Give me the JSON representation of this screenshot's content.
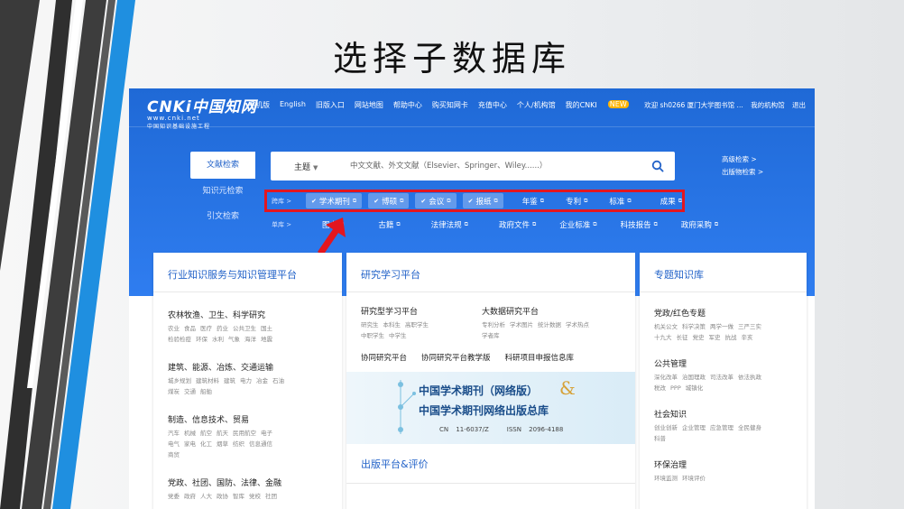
{
  "slide": {
    "title": "选择子数据库"
  },
  "logo": {
    "main": "CNKi中国知网",
    "url": "www.cnki.net",
    "sub": "中国知识基础设施工程"
  },
  "topnav": [
    "手机版",
    "English",
    "旧版入口",
    "网站地图",
    "帮助中心",
    "购买知网卡",
    "充值中心",
    "个人/机构馆",
    "我的CNKI"
  ],
  "topnav_badge": "NEW",
  "user": {
    "welcome": "欢迎  sh0266 厦门大学图书馆 ...",
    "links": [
      "我的机构馆",
      "退出"
    ]
  },
  "side_tabs": [
    "文献检索",
    "知识元检索",
    "引文检索"
  ],
  "search": {
    "field": "主题",
    "placeholder": "中文文献、外文文献（Elsevier、Springer、Wiley......）"
  },
  "adv_links": [
    "高级检索  >",
    "出版物检索  >"
  ],
  "db_row1": {
    "prefix": "跨库  >",
    "selected": [
      "学术期刊",
      "博硕",
      "会议",
      "报纸"
    ],
    "plain": [
      "年鉴",
      "专利",
      "标准",
      "成果"
    ]
  },
  "db_row2": {
    "prefix": "单库  >",
    "items": [
      "图书",
      "古籍",
      "法律法规",
      "政府文件",
      "企业标准",
      "科技报告",
      "政府采购"
    ]
  },
  "panel1": {
    "title": "行业知识服务与知识管理平台",
    "categories": [
      {
        "title": "农林牧渔、卫生、科学研究",
        "subs": [
          "农业",
          "食品",
          "医疗",
          "药业",
          "公共卫生",
          "国土",
          "检验检疫",
          "环保",
          "水利",
          "气象",
          "海洋",
          "地震"
        ]
      },
      {
        "title": "建筑、能源、冶炼、交通运输",
        "subs": [
          "城乡规划",
          "建筑材料",
          "建筑",
          "电力",
          "冶金",
          "石油",
          "煤炭",
          "交通",
          "船舶"
        ]
      },
      {
        "title": "制造、信息技术、贸易",
        "subs": [
          "汽车",
          "机械",
          "航空",
          "航天",
          "民用航空",
          "电子",
          "电气",
          "家电",
          "化工",
          "烟草",
          "纺织",
          "信息通信",
          "商贸"
        ]
      },
      {
        "title": "党政、社团、国防、法律、金融",
        "subs": [
          "党委",
          "政府",
          "人大",
          "政协",
          "智库",
          "党校",
          "社团"
        ]
      }
    ]
  },
  "panel2": {
    "title": "研究学习平台",
    "col1_title": "研究型学习平台",
    "col1_subs": [
      "研究生",
      "本科生",
      "高职学生",
      "中职学生",
      "中学生"
    ],
    "col2_title": "大数据研究平台",
    "col2_subs": [
      "专利分析",
      "学术图片",
      "统计数据",
      "学术热点",
      "学者库"
    ],
    "links": [
      "协同研究平台",
      "协同研究平台教学版",
      "科研项目申报信息库"
    ],
    "banner": {
      "line1": "中国学术期刊（网络版）",
      "amp": "&",
      "line2": "中国学术期刊网络出版总库",
      "cn": "CN 11-6037/Z",
      "issn": "ISSN 2096-4188"
    },
    "pub_title": "出版平台&评价"
  },
  "panel3": {
    "title": "专题知识库",
    "topics": [
      {
        "title": "党政/红色专题",
        "subs": [
          "机关公文",
          "科学决策",
          "两学一做",
          "三严三实",
          "十九大",
          "长征",
          "党史",
          "军史",
          "抗战",
          "辛亥"
        ]
      },
      {
        "title": "公共管理",
        "subs": [
          "深化改革",
          "治国理政",
          "司法改革",
          "依法执政",
          "税改",
          "PPP",
          "城镇化"
        ]
      },
      {
        "title": "社会知识",
        "subs": [
          "创业创新",
          "企业管理",
          "应急管理",
          "全民健身",
          "科普"
        ]
      },
      {
        "title": "环保治理",
        "subs": [
          "环境监测",
          "环境评价"
        ]
      }
    ]
  },
  "colors": {
    "brand_blue": "#2f7df0",
    "highlight_red": "#e3161f",
    "panel_title": "#2262c8"
  }
}
